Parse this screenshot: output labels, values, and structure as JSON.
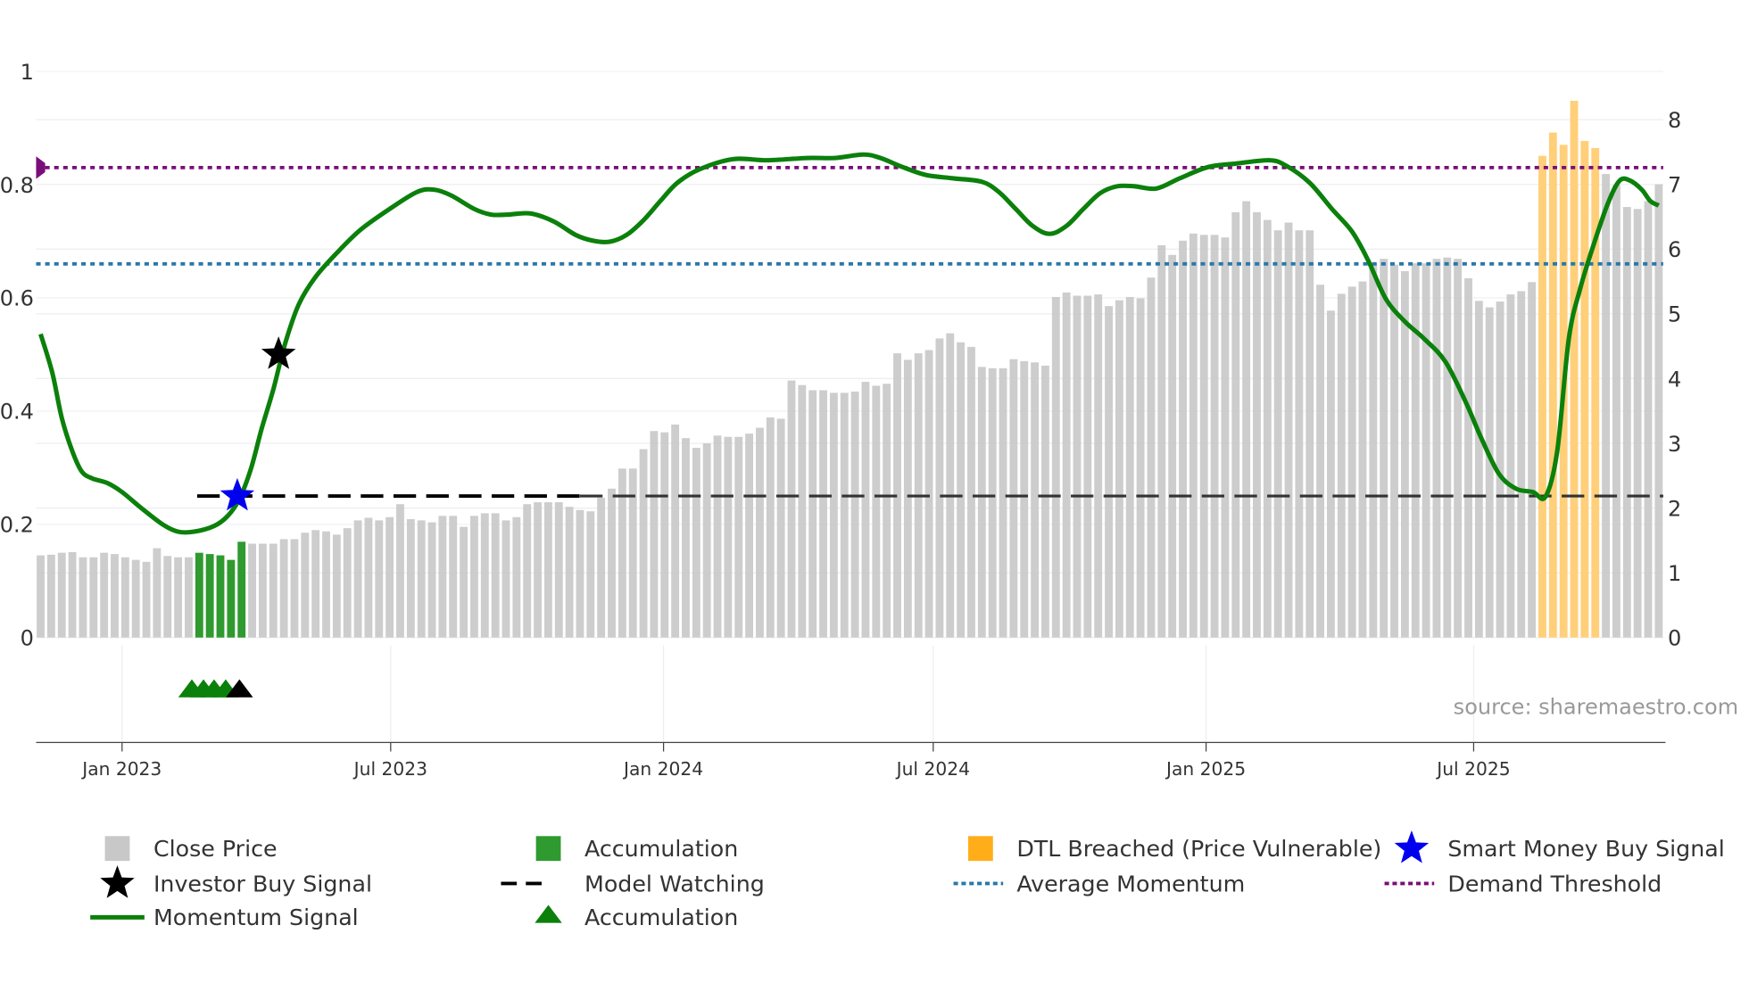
{
  "chart_data": {
    "type": "bar",
    "title": "",
    "source": "source: sharemaestro.com",
    "x_unit": "week index (weekly bars, first bar approx. Nov 2022)",
    "x_ticks": [
      {
        "label": "Jan 2023",
        "week": 7.7
      },
      {
        "label": "Jul 2023",
        "week": 33.1
      },
      {
        "label": "Jan 2024",
        "week": 58.9
      },
      {
        "label": "Jul 2024",
        "week": 84.4
      },
      {
        "label": "Jan 2025",
        "week": 110.2
      },
      {
        "label": "Jul 2025",
        "week": 135.5
      }
    ],
    "left_axis": {
      "range": [
        0,
        1
      ],
      "ticks": [
        "0",
        "0.2",
        "0.4",
        "0.6",
        "0.8",
        "1"
      ],
      "tick_values": [
        0,
        0.2,
        0.4,
        0.6,
        0.8,
        1
      ]
    },
    "right_axis": {
      "range": [
        0,
        8
      ],
      "ticks": [
        "0",
        "1",
        "2",
        "3",
        "4",
        "5",
        "6",
        "7",
        "8"
      ],
      "tick_values": [
        0,
        1,
        2,
        3,
        4,
        5,
        6,
        7,
        8
      ]
    },
    "close_price": [
      1.27,
      1.28,
      1.31,
      1.32,
      1.24,
      1.24,
      1.31,
      1.29,
      1.24,
      1.2,
      1.17,
      1.38,
      1.26,
      1.24,
      1.24,
      1.31,
      1.29,
      1.27,
      1.2,
      1.48,
      1.45,
      1.45,
      1.45,
      1.52,
      1.52,
      1.62,
      1.66,
      1.64,
      1.59,
      1.69,
      1.81,
      1.85,
      1.81,
      1.86,
      2.06,
      1.83,
      1.81,
      1.78,
      1.88,
      1.88,
      1.71,
      1.88,
      1.92,
      1.92,
      1.81,
      1.86,
      2.06,
      2.09,
      2.09,
      2.09,
      2.02,
      1.97,
      1.95,
      2.16,
      2.3,
      2.61,
      2.61,
      2.91,
      3.19,
      3.17,
      3.29,
      3.08,
      2.93,
      3.0,
      3.12,
      3.1,
      3.1,
      3.15,
      3.24,
      3.4,
      3.38,
      3.97,
      3.9,
      3.82,
      3.82,
      3.78,
      3.78,
      3.8,
      3.95,
      3.89,
      3.92,
      4.39,
      4.29,
      4.39,
      4.44,
      4.62,
      4.7,
      4.56,
      4.49,
      4.18,
      4.16,
      4.16,
      4.3,
      4.27,
      4.25,
      4.2,
      5.26,
      5.33,
      5.28,
      5.28,
      5.3,
      5.12,
      5.21,
      5.26,
      5.24,
      5.56,
      6.06,
      5.91,
      6.13,
      6.24,
      6.22,
      6.22,
      6.18,
      6.57,
      6.74,
      6.57,
      6.45,
      6.29,
      6.41,
      6.29,
      6.29,
      5.45,
      5.05,
      5.31,
      5.42,
      5.5,
      5.78,
      5.85,
      5.76,
      5.66,
      5.78,
      5.78,
      5.85,
      5.87,
      5.85,
      5.55,
      5.2,
      5.1,
      5.19,
      5.3,
      5.35,
      5.49,
      7.44,
      7.8,
      7.61,
      8.29,
      7.67,
      7.56,
      7.16,
      6.99,
      6.65,
      6.62,
      6.74,
      7.0
    ],
    "accumulation_bars": [
      15,
      16,
      17,
      18,
      19
    ],
    "dtl_breached_bars": [
      142,
      143,
      144,
      145,
      146,
      147
    ],
    "momentum": [
      [
        0,
        0.536
      ],
      [
        1.1,
        0.468
      ],
      [
        2.0,
        0.388
      ],
      [
        3.0,
        0.329
      ],
      [
        3.9,
        0.293
      ],
      [
        4.9,
        0.281
      ],
      [
        6.3,
        0.273
      ],
      [
        7.7,
        0.257
      ],
      [
        9.5,
        0.229
      ],
      [
        11.6,
        0.199
      ],
      [
        13.0,
        0.187
      ],
      [
        14.5,
        0.187
      ],
      [
        16.4,
        0.197
      ],
      [
        17.7,
        0.215
      ],
      [
        18.8,
        0.245
      ],
      [
        19.9,
        0.299
      ],
      [
        20.9,
        0.369
      ],
      [
        22.0,
        0.438
      ],
      [
        23.1,
        0.518
      ],
      [
        24.4,
        0.588
      ],
      [
        26.0,
        0.637
      ],
      [
        28.2,
        0.683
      ],
      [
        30.3,
        0.721
      ],
      [
        33.0,
        0.757
      ],
      [
        35.6,
        0.787
      ],
      [
        37.2,
        0.791
      ],
      [
        38.8,
        0.781
      ],
      [
        41.0,
        0.757
      ],
      [
        42.6,
        0.747
      ],
      [
        44.2,
        0.747
      ],
      [
        46.3,
        0.749
      ],
      [
        48.5,
        0.735
      ],
      [
        50.6,
        0.711
      ],
      [
        52.2,
        0.701
      ],
      [
        53.8,
        0.699
      ],
      [
        55.4,
        0.711
      ],
      [
        57.0,
        0.737
      ],
      [
        58.6,
        0.771
      ],
      [
        60.2,
        0.803
      ],
      [
        62.3,
        0.827
      ],
      [
        65.5,
        0.845
      ],
      [
        68.7,
        0.843
      ],
      [
        72.5,
        0.847
      ],
      [
        75.1,
        0.847
      ],
      [
        77.8,
        0.853
      ],
      [
        79.4,
        0.847
      ],
      [
        81.5,
        0.831
      ],
      [
        83.7,
        0.817
      ],
      [
        86.3,
        0.811
      ],
      [
        89.0,
        0.805
      ],
      [
        90.6,
        0.787
      ],
      [
        92.2,
        0.757
      ],
      [
        93.8,
        0.727
      ],
      [
        95.4,
        0.713
      ],
      [
        97.0,
        0.727
      ],
      [
        98.6,
        0.757
      ],
      [
        100.2,
        0.785
      ],
      [
        101.8,
        0.797
      ],
      [
        103.4,
        0.797
      ],
      [
        105.5,
        0.793
      ],
      [
        107.7,
        0.811
      ],
      [
        110.4,
        0.831
      ],
      [
        113.0,
        0.837
      ],
      [
        116.2,
        0.843
      ],
      [
        117.8,
        0.833
      ],
      [
        120.0,
        0.803
      ],
      [
        122.1,
        0.757
      ],
      [
        124.0,
        0.717
      ],
      [
        125.5,
        0.667
      ],
      [
        127.2,
        0.598
      ],
      [
        129.0,
        0.558
      ],
      [
        130.8,
        0.528
      ],
      [
        132.8,
        0.488
      ],
      [
        134.7,
        0.418
      ],
      [
        136.3,
        0.349
      ],
      [
        137.9,
        0.289
      ],
      [
        139.5,
        0.263
      ],
      [
        141.1,
        0.257
      ],
      [
        142.3,
        0.249
      ],
      [
        143.4,
        0.329
      ],
      [
        144.5,
        0.528
      ],
      [
        145.6,
        0.618
      ],
      [
        146.9,
        0.697
      ],
      [
        148.2,
        0.767
      ],
      [
        149.3,
        0.807
      ],
      [
        150.3,
        0.807
      ],
      [
        151.4,
        0.791
      ],
      [
        152.2,
        0.771
      ],
      [
        153.0,
        0.763
      ]
    ],
    "demand_threshold": 0.83,
    "average_momentum": 0.66,
    "model_watching": {
      "value": 0.25,
      "start_week": 14.8,
      "solid_until_week": 51
    },
    "smart_money_buy_signal": {
      "week": 18.6,
      "value": 0.25
    },
    "investor_buy_signal": {
      "week": 22.5,
      "value": 0.5
    },
    "accumulation_markers": [
      14.3,
      15.4,
      16.4,
      17.5
    ],
    "investor_marker": 18.8,
    "legend_placement": "bottom",
    "legend": [
      {
        "label": "Close Price",
        "icon": "gray-square"
      },
      {
        "label": "Accumulation",
        "icon": "green-square"
      },
      {
        "label": "DTL Breached (Price Vulnerable)",
        "icon": "orange-square"
      },
      {
        "label": "Smart Money Buy Signal",
        "icon": "blue-star"
      },
      {
        "label": "Investor Buy Signal",
        "icon": "black-star"
      },
      {
        "label": "Model Watching",
        "icon": "black-dash"
      },
      {
        "label": "Average Momentum",
        "icon": "blue-dots"
      },
      {
        "label": "Demand Threshold",
        "icon": "purple-dots"
      },
      {
        "label": "Momentum Signal",
        "icon": "green-line"
      },
      {
        "label": "Accumulation",
        "icon": "green-triangle"
      }
    ],
    "colors": {
      "close": "#c8c8c8",
      "accum": "#2f9a2f",
      "dtl": "#ffcf7a",
      "momentum": "#0b800b",
      "demand": "#7a0f7a",
      "avg": "#2a78a8",
      "smart": "#0000ee",
      "investor": "#000000"
    }
  }
}
